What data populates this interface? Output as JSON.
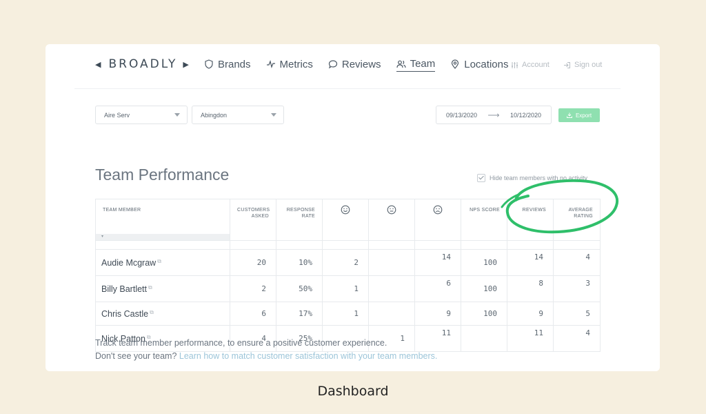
{
  "brand": {
    "name": "BROADLY"
  },
  "nav": {
    "items": [
      {
        "label": "Brands",
        "icon": "shield-icon"
      },
      {
        "label": "Metrics",
        "icon": "pulse-icon"
      },
      {
        "label": "Reviews",
        "icon": "chat-bubble-icon"
      },
      {
        "label": "Team",
        "icon": "people-icon",
        "active": true
      },
      {
        "label": "Locations",
        "icon": "map-pin-icon"
      }
    ],
    "account_label": "Account",
    "signout_label": "Sign out"
  },
  "filters": {
    "brand_select": "Aire Serv",
    "location_select": "Abingdon",
    "date_from": "09/13/2020",
    "date_to": "10/12/2020",
    "export_label": "Export"
  },
  "page": {
    "title": "Team Performance",
    "hide_inactive_label": "Hide team members with no activity",
    "hide_inactive_checked": true
  },
  "table": {
    "headers": {
      "member": "TEAM MEMBER",
      "asked": "CUSTOMERS ASKED",
      "response": "RESPONSE RATE",
      "happy": "happy-face-icon",
      "neutral": "neutral-face-icon",
      "sad": "sad-face-icon",
      "nps": "NPS SCORE",
      "reviews": "REVIEWS",
      "rating": "AVERAGE RATING"
    },
    "sort_indicator": "▾",
    "rows": [
      {
        "name": "Audie Mcgraw",
        "asked": "20",
        "response": "10%",
        "happy": "2",
        "neutral": "",
        "sad": "14",
        "nps": "100",
        "reviews": "14",
        "rating": "4"
      },
      {
        "name": "Billy Bartlett",
        "asked": "2",
        "response": "50%",
        "happy": "1",
        "neutral": "",
        "sad": "6",
        "nps": "100",
        "reviews": "8",
        "rating": "3"
      },
      {
        "name": "Chris Castle",
        "asked": "6",
        "response": "17%",
        "happy": "1",
        "neutral": "",
        "sad": "9",
        "nps": "100",
        "reviews": "9",
        "rating": "5"
      },
      {
        "name": "Nick Patton",
        "asked": "4",
        "response": "25%",
        "happy": "",
        "neutral": "1",
        "sad": "11",
        "nps": "",
        "reviews": "11",
        "rating": "4"
      }
    ]
  },
  "footer": {
    "line1": "Track team member performance, to ensure a positive customer experience.",
    "line2_prefix": "Don't see your team? ",
    "line2_link": "Learn how to match customer satisfaction with your team members."
  },
  "caption": "Dashboard",
  "colors": {
    "accent_green": "#2fbf6a",
    "export_bg": "#8fe0b0",
    "page_bg": "#f6efdf"
  }
}
